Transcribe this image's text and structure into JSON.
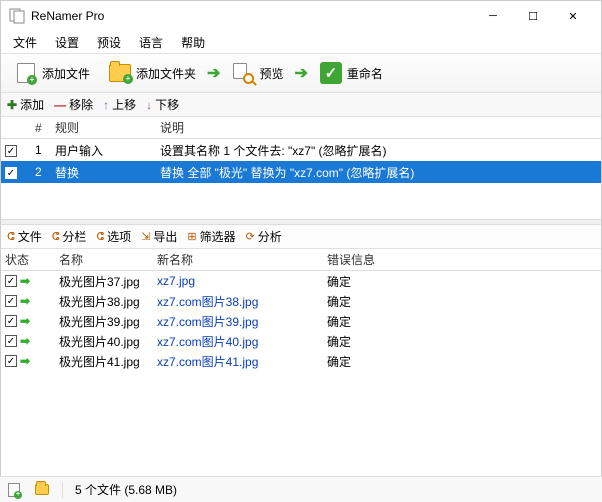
{
  "window": {
    "title": "ReNamer Pro"
  },
  "menu": {
    "file": "文件",
    "settings": "设置",
    "presets": "预设",
    "language": "语言",
    "help": "帮助"
  },
  "toolbar": {
    "add_files": "添加文件",
    "add_folder": "添加文件夹",
    "preview": "预览",
    "rename": "重命名"
  },
  "rulebar": {
    "add": "添加",
    "remove": "移除",
    "move_up": "上移",
    "move_down": "下移"
  },
  "rule_headers": {
    "num": "#",
    "type": "规则",
    "desc": "说明"
  },
  "rules": [
    {
      "num": "1",
      "type": "用户输入",
      "desc": "设置其名称 1 个文件去: \"xz7\" (忽略扩展名)",
      "selected": false
    },
    {
      "num": "2",
      "type": "替换",
      "desc": "替换 全部 \"极光\" 替换为 \"xz7.com\" (忽略扩展名)",
      "selected": true
    }
  ],
  "filebar": {
    "files": "文件",
    "columns": "分栏",
    "options": "选项",
    "export": "导出",
    "filter": "筛选器",
    "analyze": "分析"
  },
  "file_headers": {
    "status": "状态",
    "name": "名称",
    "newname": "新名称",
    "error": "错误信息"
  },
  "files": [
    {
      "name": "极光图片37.jpg",
      "newname": "xz7.jpg",
      "error": "确定"
    },
    {
      "name": "极光图片38.jpg",
      "newname": "xz7.com图片38.jpg",
      "error": "确定"
    },
    {
      "name": "极光图片39.jpg",
      "newname": "xz7.com图片39.jpg",
      "error": "确定"
    },
    {
      "name": "极光图片40.jpg",
      "newname": "xz7.com图片40.jpg",
      "error": "确定"
    },
    {
      "name": "极光图片41.jpg",
      "newname": "xz7.com图片41.jpg",
      "error": "确定"
    }
  ],
  "statusbar": {
    "summary": "5 个文件 (5.68 MB)"
  }
}
